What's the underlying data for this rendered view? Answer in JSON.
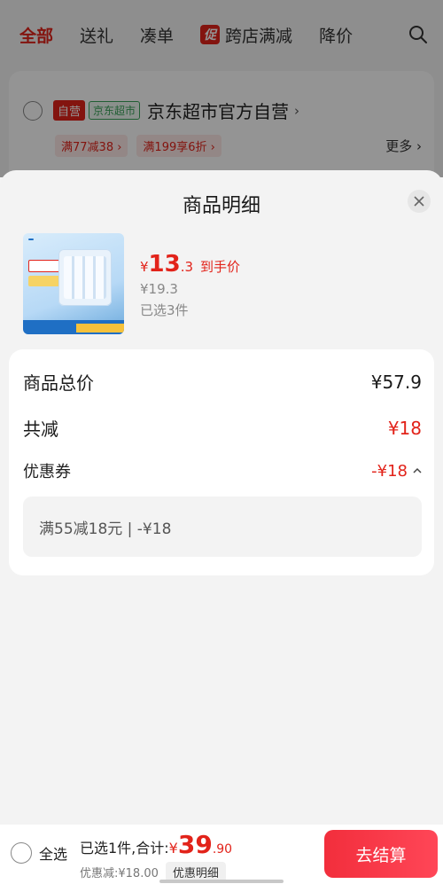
{
  "top_tabs": [
    {
      "label": "全部",
      "active": true
    },
    {
      "label": "送礼",
      "active": false
    },
    {
      "label": "凑单",
      "active": false
    },
    {
      "label": "跨店满减",
      "active": false,
      "badge": "促"
    },
    {
      "label": "降价",
      "active": false
    }
  ],
  "shop": {
    "tag_self": "自营",
    "tag_market": "京东超市",
    "name": "京东超市官方自营",
    "coupons": [
      "满77减38 ›",
      "满199享6折 ›"
    ],
    "more": "更多 ›"
  },
  "sheet": {
    "title": "商品明细",
    "product": {
      "price_yen": "¥",
      "price_int": "13",
      "price_dec": ".3",
      "price_tag": "到手价",
      "original_price": "¥19.3",
      "selected": "已选3件"
    },
    "detail": {
      "total_label": "商品总价",
      "total_value": "¥57.9",
      "reduce_label": "共减",
      "reduce_value": "¥18",
      "coupon_label": "优惠券",
      "coupon_value": "-¥18",
      "coupon_item": "满55减18元 | -¥18"
    }
  },
  "bottom": {
    "select_all": "全选",
    "total_prefix": "已选1件,合计:",
    "total_yen": "¥",
    "total_int": "39",
    "total_dec": ".90",
    "discount": "优惠减:¥18.00",
    "detail_button": "优惠明细",
    "checkout": "去结算"
  },
  "colors": {
    "accent": "#e2231a",
    "market_green": "#3aa35b"
  }
}
